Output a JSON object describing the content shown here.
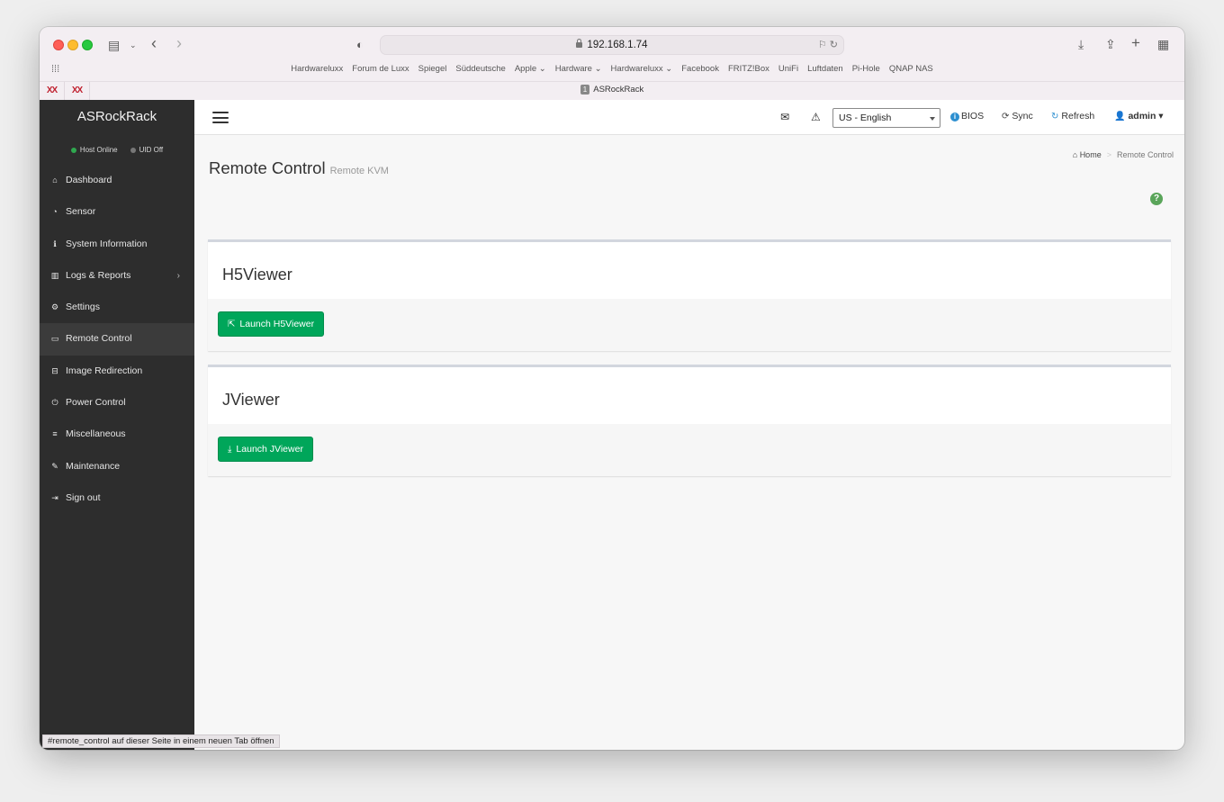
{
  "browser": {
    "url": "192.168.1.74",
    "bookmarks": [
      "Hardwareluxx",
      "Forum de Luxx",
      "Spiegel",
      "Süddeutsche",
      "Apple ⌄",
      "Hardware ⌄",
      "Hardwareluxx ⌄",
      "Facebook",
      "FRITZ!Box",
      "UniFi",
      "Luftdaten",
      "Pi-Hole",
      "QNAP NAS"
    ],
    "pinned_tabs": [
      "XX",
      "XX"
    ],
    "tab": {
      "number": "1",
      "title": "ASRockRack"
    },
    "status_url": "#remote_control auf dieser Seite in einem neuen Tab öffnen"
  },
  "sidebar": {
    "brand": "ASRockRack",
    "status": [
      {
        "label": "Host Online",
        "color": "#2fa84f"
      },
      {
        "label": "UID Off",
        "color": "#777777"
      }
    ],
    "items": [
      {
        "label": "Dashboard",
        "icon": "home-icon",
        "glyph": "⌂"
      },
      {
        "label": "Sensor",
        "icon": "dashboard-icon",
        "glyph": "◔"
      },
      {
        "label": "System Information",
        "icon": "info-icon",
        "glyph": "ℹ"
      },
      {
        "label": "Logs & Reports",
        "icon": "bar-chart-icon",
        "glyph": "▥",
        "chevron": "›"
      },
      {
        "label": "Settings",
        "icon": "gear-icon",
        "glyph": "⚙"
      },
      {
        "label": "Remote Control",
        "icon": "desktop-icon",
        "glyph": "▭",
        "active": true
      },
      {
        "label": "Image Redirection",
        "icon": "hdd-icon",
        "glyph": "⊟"
      },
      {
        "label": "Power Control",
        "icon": "power-icon",
        "glyph": "⏻"
      },
      {
        "label": "Miscellaneous",
        "icon": "bars-icon",
        "glyph": "≡"
      },
      {
        "label": "Maintenance",
        "icon": "wrench-icon",
        "glyph": "✎"
      },
      {
        "label": "Sign out",
        "icon": "sign-out-icon",
        "glyph": "⇥"
      }
    ]
  },
  "topnav": {
    "language": "US - English",
    "bios_label": "BIOS",
    "sync_label": "Sync",
    "refresh_label": "Refresh",
    "user_label": "admin"
  },
  "page": {
    "title": "Remote Control",
    "subtitle": "Remote KVM",
    "breadcrumb_home": "Home",
    "breadcrumb_current": "Remote Control",
    "help": "?"
  },
  "viewers": [
    {
      "title": "H5Viewer",
      "button": "Launch H5Viewer",
      "icon": "external-link-icon"
    },
    {
      "title": "JViewer",
      "button": "Launch JViewer",
      "icon": "download-icon"
    }
  ]
}
